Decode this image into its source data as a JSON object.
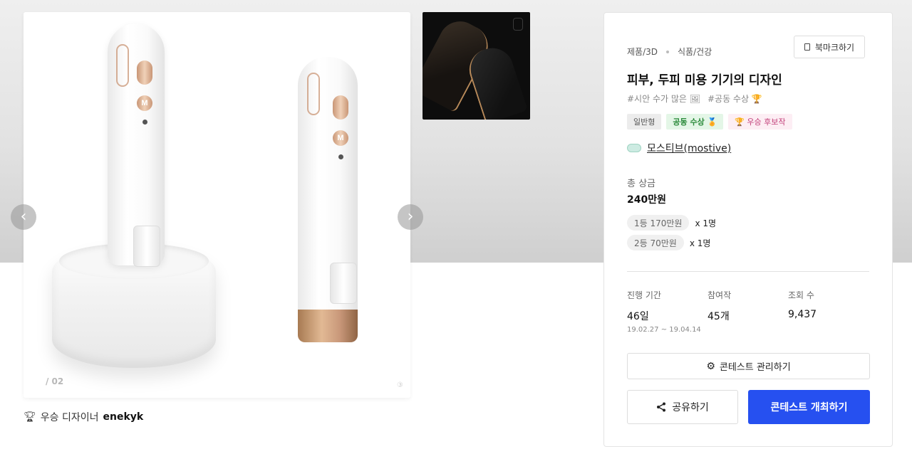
{
  "gallery": {
    "counter": "/ 02",
    "prev_arrow": "‹",
    "next_arrow": "›",
    "corner_mark": "③"
  },
  "winner": {
    "icon": "trophy-icon",
    "prefix": "우승 디자이너",
    "name": "enekyk"
  },
  "panel": {
    "categories": [
      "제품/3D",
      "식품/건강"
    ],
    "bookmark_label": "북마크하기",
    "title": "피부, 두피 미용 기기의 디자인",
    "tags": [
      "#시안 수가 많은 🖼",
      "#공동 수상 🏆"
    ],
    "badges": {
      "type": "일반형",
      "joint": "공동 수상 🏅",
      "win": "🏆 우승 후보작"
    },
    "company": "모스티브(mostive)",
    "prize": {
      "label": "총 상금",
      "total": "240만원",
      "rows": [
        {
          "rank": "1등 170만원",
          "count": "x 1명"
        },
        {
          "rank": "2등 70만원",
          "count": "x 1명"
        }
      ]
    },
    "stats": [
      {
        "label": "진행 기간",
        "value": "46일",
        "sub": "19.02.27 ~ 19.04.14"
      },
      {
        "label": "참여작",
        "value": "45개",
        "sub": ""
      },
      {
        "label": "조회 수",
        "value": "9,437",
        "sub": ""
      }
    ],
    "manage_label": "콘테스트 관리하기",
    "share_label": "공유하기",
    "host_label": "콘테스트 개최하기"
  },
  "colors": {
    "primary_button": "#2650f0",
    "joint_badge": "#e4f6e7",
    "win_badge": "#fdeef4"
  }
}
